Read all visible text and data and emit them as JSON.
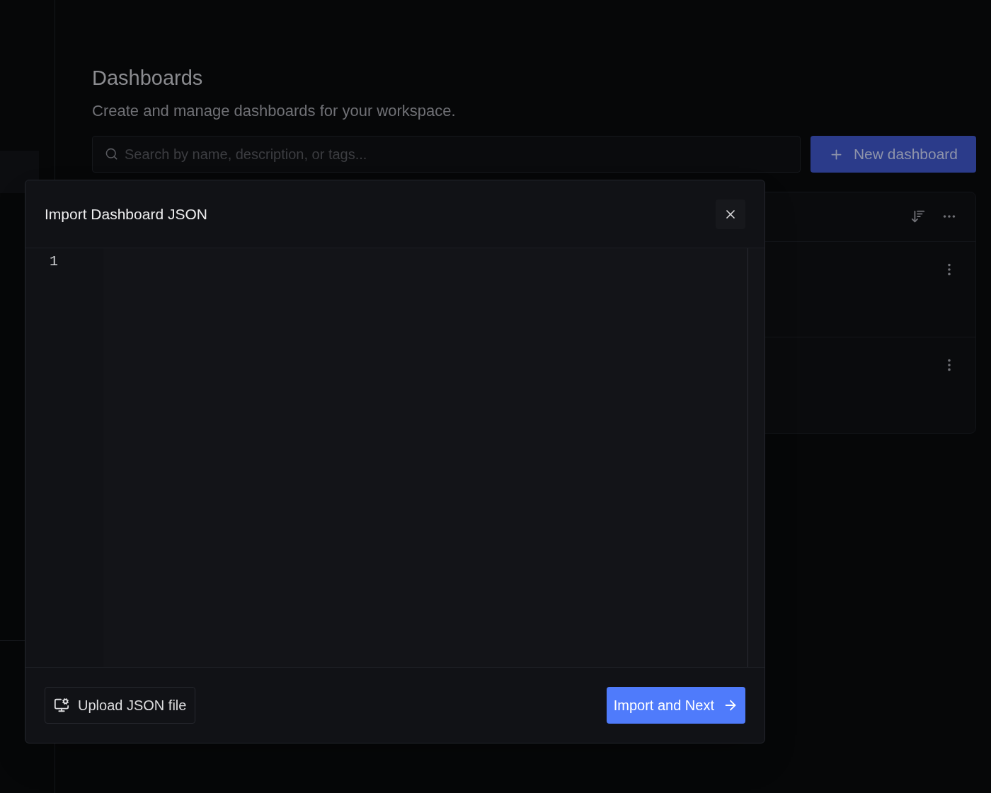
{
  "page": {
    "title": "Dashboards",
    "subtitle": "Create and manage dashboards for your workspace.",
    "search": {
      "placeholder": "Search by name, description, or tags..."
    },
    "new_button": "New dashboard"
  },
  "dialog": {
    "title": "Import Dashboard JSON",
    "editor": {
      "line_numbers": [
        "1"
      ]
    },
    "upload_button": "Upload JSON file",
    "primary_button": "Import and Next"
  }
}
